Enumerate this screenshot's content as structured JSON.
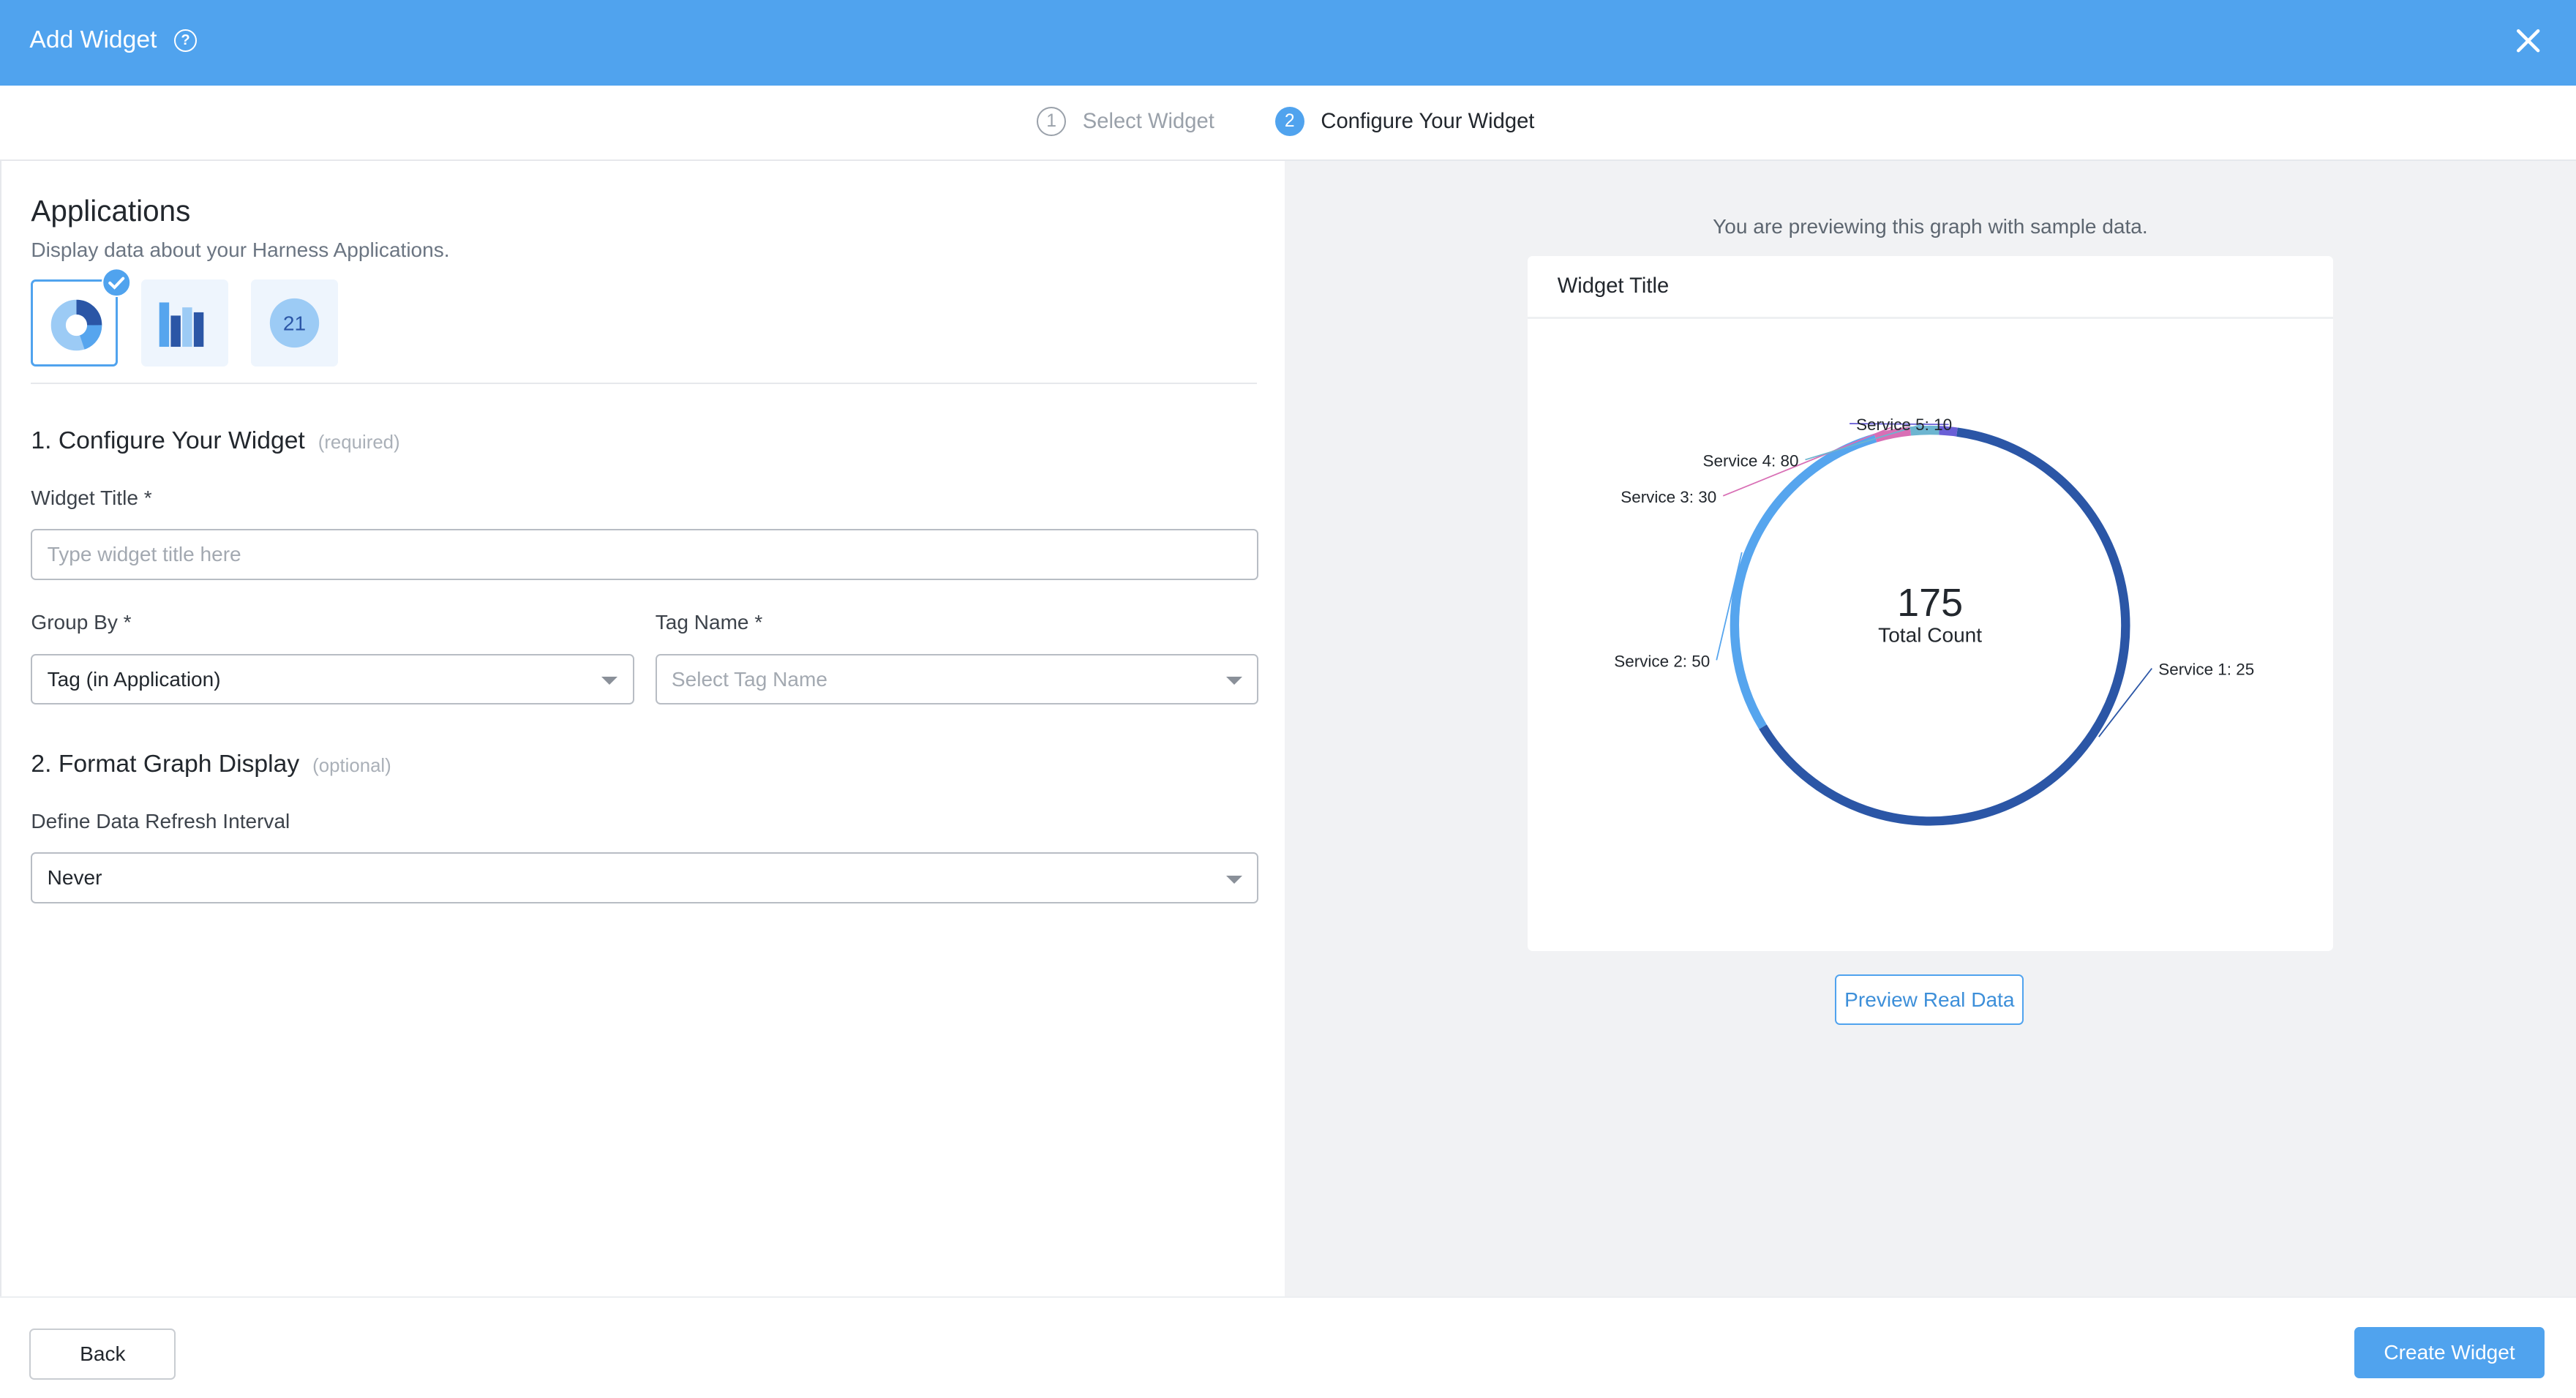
{
  "header": {
    "title": "Add Widget"
  },
  "stepper": [
    {
      "num": "1",
      "label": "Select Widget"
    },
    {
      "num": "2",
      "label": "Configure Your Widget"
    }
  ],
  "section": {
    "title": "Applications",
    "description": "Display data about your Harness Applications.",
    "visualization_options": [
      {
        "name": "donut-chart-icon",
        "selected": true
      },
      {
        "name": "bar-chart-icon",
        "selected": false
      },
      {
        "name": "single-value-icon",
        "value": "21",
        "selected": false
      }
    ]
  },
  "configure": {
    "heading": "1. Configure Your Widget",
    "heading_hint": "(required)",
    "widget_title_label": "Widget Title *",
    "widget_title_placeholder": "Type widget title here",
    "group_by_label": "Group By *",
    "group_by_value": "Tag (in Application)",
    "tag_name_label": "Tag Name *",
    "tag_name_placeholder": "Select Tag Name"
  },
  "format": {
    "heading": "2. Format Graph Display",
    "heading_hint": "(optional)",
    "refresh_label": "Define Data Refresh Interval",
    "refresh_value": "Never"
  },
  "preview": {
    "note": "You are previewing this graph with sample data.",
    "card_title": "Widget Title",
    "preview_button": "Preview Real Data"
  },
  "chart_data": {
    "type": "pie",
    "variant": "donut",
    "center_value": "175",
    "center_label": "Total Count",
    "slices": [
      {
        "label": "Service 1: 25",
        "value": 110,
        "color": "#2b56a6"
      },
      {
        "label": "Service 2: 50",
        "value": 50,
        "color": "#56a5ee"
      },
      {
        "label": "Service 3: 30",
        "value": 5,
        "color": "#d86fb5"
      },
      {
        "label": "Service 4: 80",
        "value": 4,
        "color": "#6cb5d0"
      },
      {
        "label": "Service 5: 10",
        "value": 2.5,
        "color": "#6a5fd6"
      }
    ]
  },
  "footer": {
    "back_label": "Back",
    "create_label": "Create Widget"
  },
  "colors": {
    "accent": "#50a3ee",
    "preview_bg": "#f1f2f4"
  }
}
